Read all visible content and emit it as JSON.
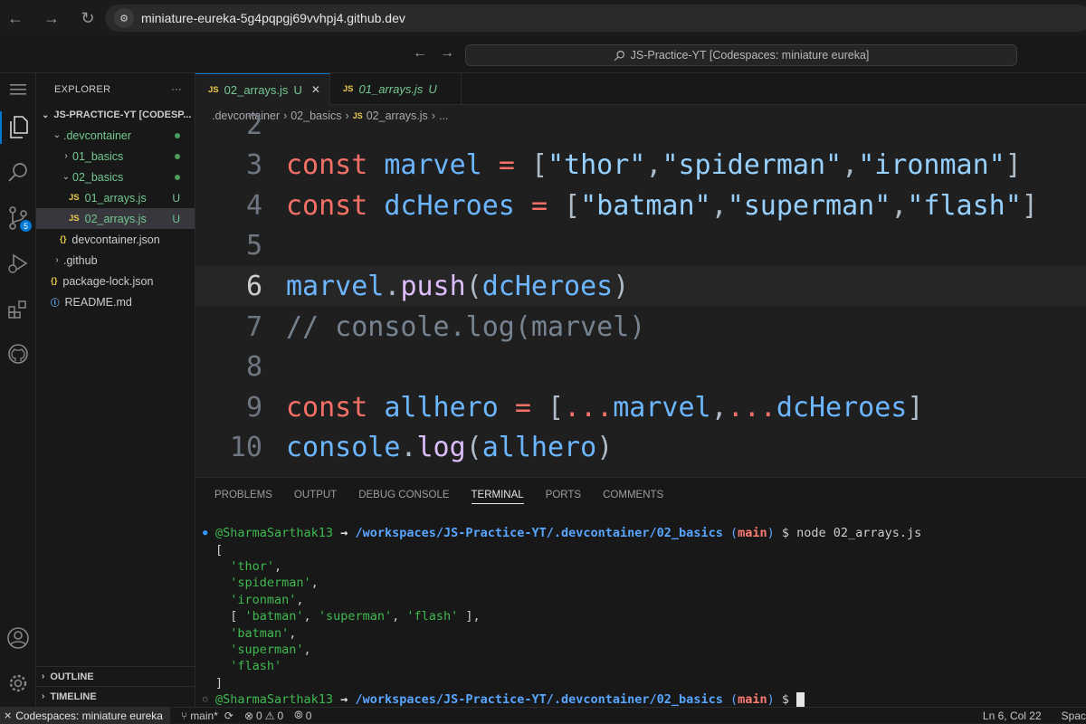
{
  "browser": {
    "url": "miniature-eureka-5g4pqpgj69vvhpj4.github.dev",
    "icons": [
      "back-icon",
      "forward-icon",
      "reload-icon",
      "site-settings-icon"
    ]
  },
  "titlebar": {
    "command_center": "JS-Practice-YT [Codespaces: miniature eureka]"
  },
  "activity_bar": {
    "source_control_badge": "5",
    "icons": [
      "menu-icon",
      "explorer-icon",
      "search-icon",
      "source-control-icon",
      "run-debug-icon",
      "extensions-icon",
      "github-icon",
      "account-icon",
      "settings-gear-icon"
    ]
  },
  "explorer": {
    "header": "EXPLORER",
    "more": "···",
    "root": "JS-PRACTICE-YT [CODESP...",
    "tree": [
      {
        "label": ".devcontainer",
        "kind": "folder",
        "open": true,
        "indent": 1,
        "git": "dot",
        "color": "#73c991"
      },
      {
        "label": "01_basics",
        "kind": "folder",
        "open": false,
        "indent": 2,
        "git": "dot",
        "color": "#73c991"
      },
      {
        "label": "02_basics",
        "kind": "folder",
        "open": true,
        "indent": 2,
        "git": "dot",
        "color": "#73c991"
      },
      {
        "label": "01_arrays.js",
        "kind": "js",
        "indent": 3,
        "git": "U",
        "color": "#73c991"
      },
      {
        "label": "02_arrays.js",
        "kind": "js",
        "indent": 3,
        "git": "U",
        "color": "#73c991",
        "selected": true
      },
      {
        "label": "devcontainer.json",
        "kind": "json",
        "indent": 2,
        "git": "",
        "color": "#cccccc"
      },
      {
        "label": ".github",
        "kind": "folder",
        "open": false,
        "indent": 1,
        "git": "",
        "color": "#cccccc"
      },
      {
        "label": "package-lock.json",
        "kind": "json",
        "indent": 1,
        "git": "",
        "color": "#cccccc"
      },
      {
        "label": "README.md",
        "kind": "info",
        "indent": 1,
        "git": "",
        "color": "#cccccc"
      }
    ],
    "outline": "OUTLINE",
    "timeline": "TIMELINE"
  },
  "tabs": [
    {
      "icon": "JS",
      "label": "02_arrays.js",
      "status": "U",
      "close": "✕",
      "active": true
    },
    {
      "icon": "JS",
      "label": "01_arrays.js",
      "status": "U",
      "active": false
    }
  ],
  "breadcrumbs": [
    ".devcontainer",
    "02_basics",
    "02_arrays.js",
    "..."
  ],
  "code_lines": [
    {
      "n": "2",
      "tokens": []
    },
    {
      "n": "3",
      "tokens": [
        [
          "kw",
          "const "
        ],
        [
          "id",
          "marvel "
        ],
        [
          "op",
          "= "
        ],
        [
          "pl",
          "["
        ],
        [
          "st",
          "\"thor\""
        ],
        [
          "pl",
          ","
        ],
        [
          "st",
          "\"spiderman\""
        ],
        [
          "pl",
          ","
        ],
        [
          "st",
          "\"ironman\""
        ],
        [
          "pl",
          "]"
        ]
      ]
    },
    {
      "n": "4",
      "tokens": [
        [
          "kw",
          "const "
        ],
        [
          "id",
          "dcHeroes "
        ],
        [
          "op",
          "= "
        ],
        [
          "pl",
          "["
        ],
        [
          "st",
          "\"batman\""
        ],
        [
          "pl",
          ","
        ],
        [
          "st",
          "\"superman\""
        ],
        [
          "pl",
          ","
        ],
        [
          "st",
          "\"flash\""
        ],
        [
          "pl",
          "]"
        ]
      ]
    },
    {
      "n": "5",
      "tokens": []
    },
    {
      "n": "6",
      "current": true,
      "tokens": [
        [
          "id",
          "marvel"
        ],
        [
          "pl",
          "."
        ],
        [
          "fn",
          "push"
        ],
        [
          "pl",
          "("
        ],
        [
          "id",
          "dcHeroes"
        ],
        [
          "pl",
          ")"
        ]
      ]
    },
    {
      "n": "7",
      "tokens": [
        [
          "cm",
          "// console.log(marvel)"
        ]
      ]
    },
    {
      "n": "8",
      "tokens": []
    },
    {
      "n": "9",
      "tokens": [
        [
          "kw",
          "const "
        ],
        [
          "id",
          "allhero "
        ],
        [
          "op",
          "= "
        ],
        [
          "pl",
          "["
        ],
        [
          "op",
          "..."
        ],
        [
          "id",
          "marvel"
        ],
        [
          "pl",
          ","
        ],
        [
          "op",
          "..."
        ],
        [
          "id",
          "dcHeroes"
        ],
        [
          "pl",
          "]"
        ]
      ]
    },
    {
      "n": "10",
      "tokens": [
        [
          "id",
          "console"
        ],
        [
          "pl",
          "."
        ],
        [
          "fn",
          "log"
        ],
        [
          "pl",
          "("
        ],
        [
          "id",
          "allhero"
        ],
        [
          "pl",
          ")"
        ]
      ]
    }
  ],
  "panel": {
    "tabs": [
      "PROBLEMS",
      "OUTPUT",
      "DEBUG CONSOLE",
      "TERMINAL",
      "PORTS",
      "COMMENTS"
    ],
    "active_tab": "TERMINAL",
    "prompt": {
      "user": "@SharmaSarthak13",
      "arrow": " → ",
      "path": "/workspaces/JS-Practice-YT/.devcontainer/02_basics",
      "branch": "main",
      "command": "node 02_arrays.js"
    },
    "output": [
      [
        [
          "pl",
          "["
        ]
      ],
      [
        [
          "pl",
          "  "
        ],
        [
          "str",
          "'thor'"
        ],
        [
          "pl",
          ","
        ]
      ],
      [
        [
          "pl",
          "  "
        ],
        [
          "str",
          "'spiderman'"
        ],
        [
          "pl",
          ","
        ]
      ],
      [
        [
          "pl",
          "  "
        ],
        [
          "str",
          "'ironman'"
        ],
        [
          "pl",
          ","
        ]
      ],
      [
        [
          "pl",
          "  [ "
        ],
        [
          "str",
          "'batman'"
        ],
        [
          "pl",
          ", "
        ],
        [
          "str",
          "'superman'"
        ],
        [
          "pl",
          ", "
        ],
        [
          "str",
          "'flash'"
        ],
        [
          "pl",
          " ],"
        ]
      ],
      [
        [
          "pl",
          "  "
        ],
        [
          "str",
          "'batman'"
        ],
        [
          "pl",
          ","
        ]
      ],
      [
        [
          "pl",
          "  "
        ],
        [
          "str",
          "'superman'"
        ],
        [
          "pl",
          ","
        ]
      ],
      [
        [
          "pl",
          "  "
        ],
        [
          "str",
          "'flash'"
        ]
      ],
      [
        [
          "pl",
          "]"
        ]
      ]
    ]
  },
  "statusbar": {
    "remote": "Codespaces: miniature eureka",
    "branch": "main*",
    "errors": "0",
    "warnings": "0",
    "ports": "0",
    "position": "Ln 6, Col 22",
    "spaces": "Spac"
  }
}
